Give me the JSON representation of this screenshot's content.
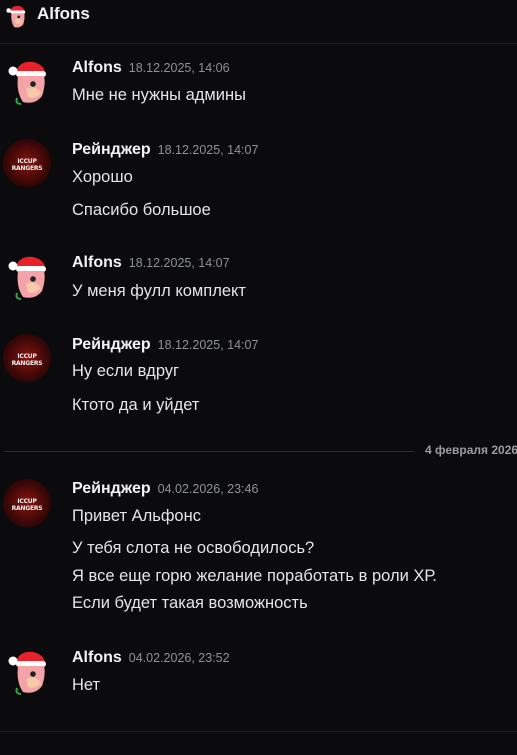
{
  "header": {
    "title": "Alfons",
    "avatar_icon": "santa-bird-icon"
  },
  "groups": [
    {
      "author": "Alfons",
      "timestamp": "18.12.2025, 14:06",
      "avatar": "santa-bird-avatar",
      "lines": [
        "Мне не нужны админы"
      ]
    },
    {
      "author": "Рейнджер",
      "timestamp": "18.12.2025, 14:07",
      "avatar": "iccup-rangers-avatar",
      "avatar_text": "ICCUP RANGERS",
      "lines": [
        "Хорошо",
        "Спасибо большое"
      ]
    },
    {
      "author": "Alfons",
      "timestamp": "18.12.2025, 14:07",
      "avatar": "santa-bird-avatar",
      "lines": [
        "У меня фулл комплект"
      ]
    },
    {
      "author": "Рейнджер",
      "timestamp": "18.12.2025, 14:07",
      "avatar": "iccup-rangers-avatar",
      "avatar_text": "ICCUP RANGERS",
      "lines": [
        "Ну если вдруг",
        "Ктото да и уйдет"
      ]
    },
    {
      "author": "Рейнджер",
      "timestamp": "04.02.2026, 23:46",
      "avatar": "iccup-rangers-avatar",
      "avatar_text": "ICCUP RANGERS",
      "lines": [
        "Привет Альфонс",
        "У тебя слота не освободилось?",
        "Я все еще горю желание поработать в роли ХР.",
        "Если будет такая возможность"
      ]
    },
    {
      "author": "Alfons",
      "timestamp": "04.02.2026, 23:52",
      "avatar": "santa-bird-avatar",
      "lines": [
        "Нет"
      ]
    }
  ],
  "date_divider": "4 февраля 2026"
}
